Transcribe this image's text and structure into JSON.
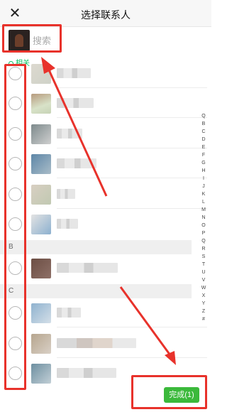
{
  "header": {
    "close_icon": "close-icon",
    "title": "选择联系人"
  },
  "search": {
    "placeholder": "搜索"
  },
  "section": {
    "label": "相关"
  },
  "groups": [
    {
      "letter": "B"
    },
    {
      "letter": "C"
    }
  ],
  "index_letters": [
    "Q",
    "B",
    "C",
    "D",
    "E",
    "F",
    "G",
    "H",
    "I",
    "J",
    "K",
    "L",
    "M",
    "N",
    "O",
    "P",
    "Q",
    "R",
    "S",
    "T",
    "U",
    "V",
    "W",
    "X",
    "Y",
    "Z",
    "#"
  ],
  "done_button": {
    "label": "完成(1)"
  },
  "colors": {
    "accent_green": "#1aad19",
    "annotation_red": "#e8322b"
  }
}
